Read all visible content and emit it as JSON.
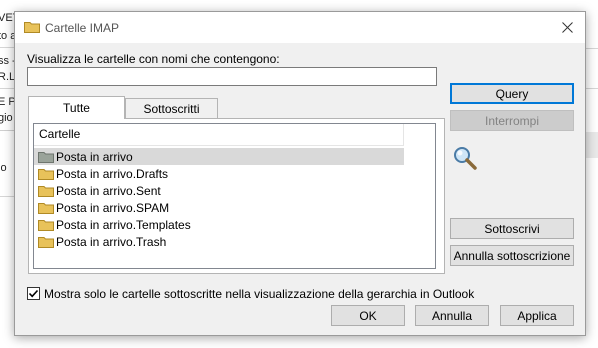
{
  "background": {
    "fragments": [
      "VET",
      "to a",
      "ss -",
      "R.L",
      "E P",
      "gio",
      "io"
    ]
  },
  "dialog": {
    "title": "Cartelle IMAP",
    "filter_label": "Visualizza le cartelle con nomi che contengono:",
    "filter_value": "",
    "tabs": [
      {
        "label": "Tutte",
        "active": true
      },
      {
        "label": "Sottoscritti",
        "active": false
      }
    ],
    "list_header": "Cartelle",
    "folders": [
      {
        "name": "Posta in arrivo",
        "selected": true
      },
      {
        "name": "Posta in arrivo.Drafts",
        "selected": false
      },
      {
        "name": "Posta in arrivo.Sent",
        "selected": false
      },
      {
        "name": "Posta in arrivo.SPAM",
        "selected": false
      },
      {
        "name": "Posta in arrivo.Templates",
        "selected": false
      },
      {
        "name": "Posta in arrivo.Trash",
        "selected": false
      }
    ],
    "buttons": {
      "query": "Query",
      "stop": "Interrompi",
      "subscribe": "Sottoscrivi",
      "unsubscribe": "Annulla sottoscrizione",
      "ok": "OK",
      "cancel": "Annulla",
      "apply": "Applica"
    },
    "checkbox": {
      "label": "Mostra solo le cartelle sottoscritte nella visualizzazione della gerarchia in Outlook",
      "checked": true
    }
  },
  "colors": {
    "folder_fill": "#e8c25a",
    "accent_border": "#0078d7"
  },
  "icons": {
    "title": "folder-icon",
    "close": "close-icon",
    "search": "magnifier-icon",
    "folder": "folder-icon"
  }
}
